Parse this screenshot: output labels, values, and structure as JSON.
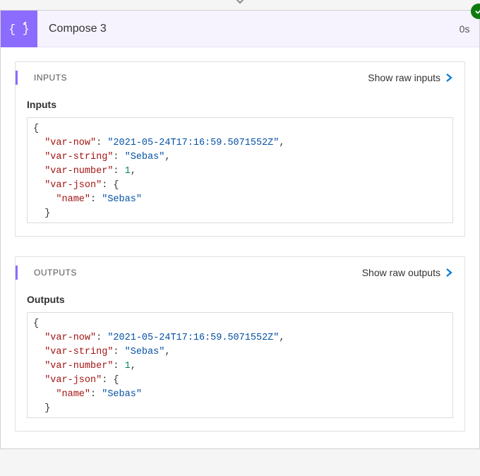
{
  "action": {
    "title": "Compose 3",
    "duration": "0s",
    "status": "success"
  },
  "sections": {
    "inputs": {
      "label": "INPUTS",
      "show_raw": "Show raw inputs",
      "sub_label": "Inputs",
      "json": {
        "var-now": "2021-05-24T17:16:59.5071552Z",
        "var-string": "Sebas",
        "var-number": 1,
        "var-json": {
          "name": "Sebas"
        }
      }
    },
    "outputs": {
      "label": "OUTPUTS",
      "show_raw": "Show raw outputs",
      "sub_label": "Outputs",
      "json": {
        "var-now": "2021-05-24T17:16:59.5071552Z",
        "var-string": "Sebas",
        "var-number": 1,
        "var-json": {
          "name": "Sebas"
        }
      }
    }
  }
}
